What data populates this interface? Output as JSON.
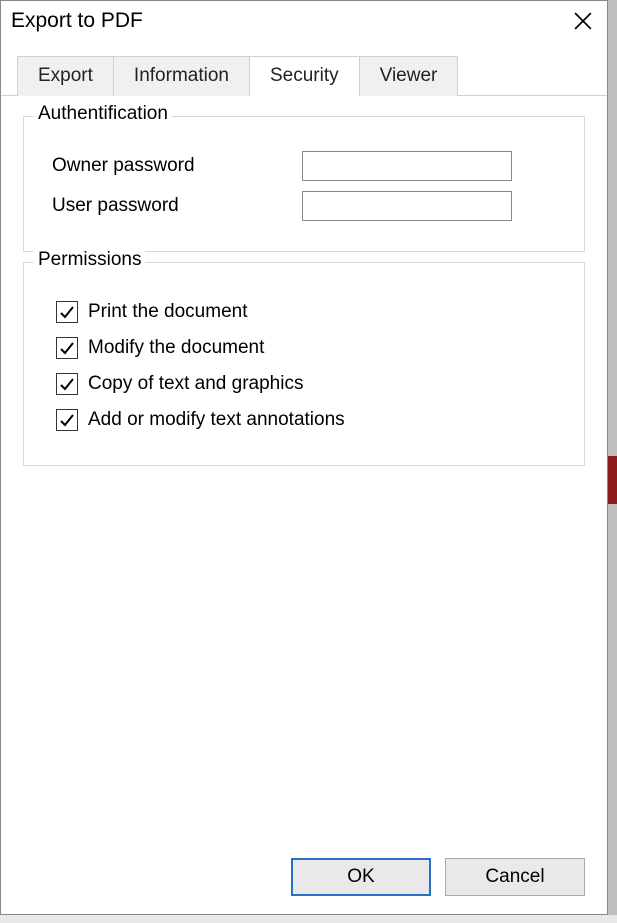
{
  "dialog": {
    "title": "Export to PDF"
  },
  "tabs": {
    "export": "Export",
    "information": "Information",
    "security": "Security",
    "viewer": "Viewer",
    "active": "security"
  },
  "auth": {
    "legend": "Authentification",
    "owner_label": "Owner password",
    "owner_value": "",
    "user_label": "User password",
    "user_value": ""
  },
  "permissions": {
    "legend": "Permissions",
    "print": {
      "label": "Print the document",
      "checked": true
    },
    "modify": {
      "label": "Modify the document",
      "checked": true
    },
    "copy": {
      "label": "Copy of text and graphics",
      "checked": true
    },
    "annotate": {
      "label": "Add or modify text annotations",
      "checked": true
    }
  },
  "buttons": {
    "ok": "OK",
    "cancel": "Cancel"
  }
}
